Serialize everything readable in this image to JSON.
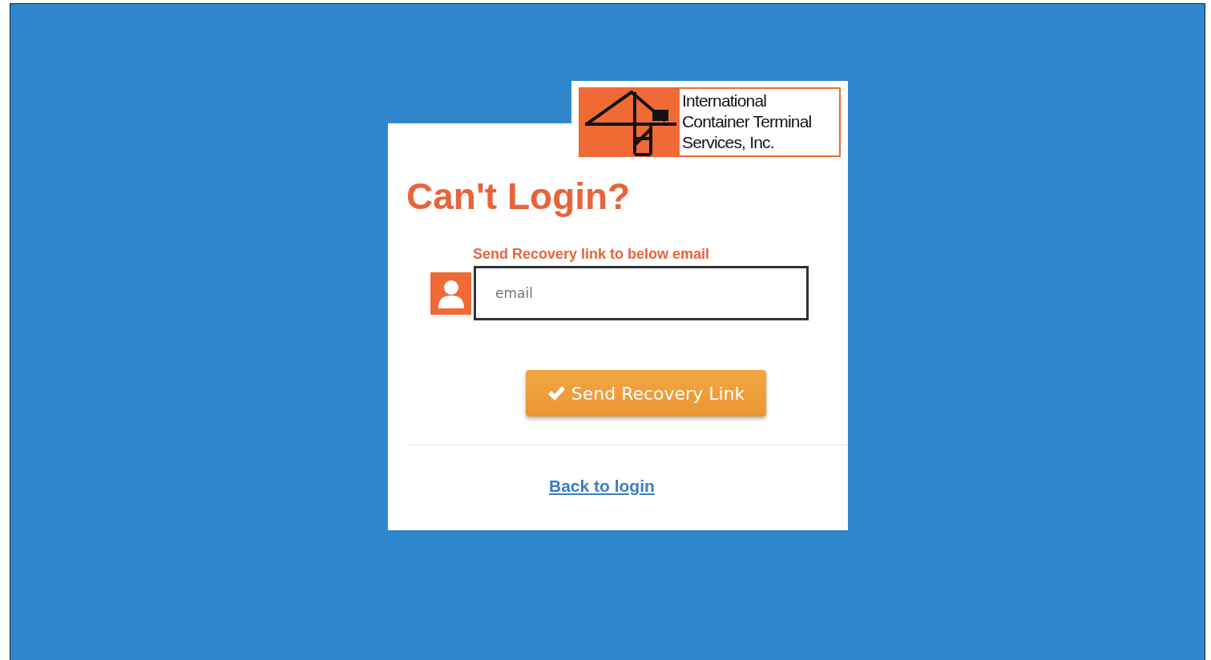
{
  "logo": {
    "lines": [
      "International",
      "Container Terminal",
      "Services, Inc."
    ]
  },
  "title": "Can't Login?",
  "instruction": "Send Recovery link to below email",
  "email_field": {
    "placeholder": "email"
  },
  "submit_button": {
    "label": "Send Recovery Link"
  },
  "back_link": {
    "label": "Back to login"
  }
}
